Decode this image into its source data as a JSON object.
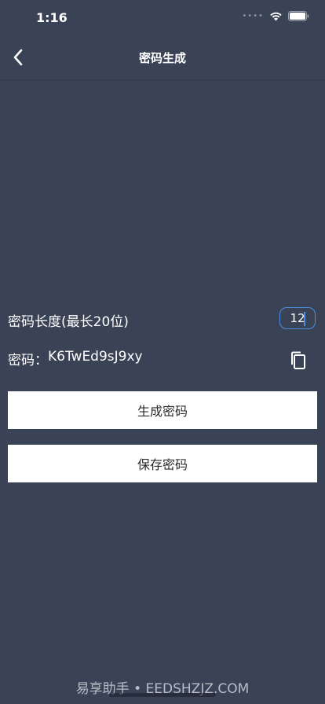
{
  "status_bar": {
    "time": "1:16",
    "icons": [
      "signal-icon",
      "wifi-icon",
      "battery-icon"
    ]
  },
  "nav": {
    "title": "密码生成",
    "back_icon": "chevron-left-icon"
  },
  "length": {
    "label": "密码长度(最长20位)",
    "value": "12"
  },
  "password": {
    "label": "密码：",
    "value": "K6TwEd9sJ9xy",
    "copy_icon": "copy-icon"
  },
  "buttons": {
    "generate": "生成密码",
    "save": "保存密码"
  },
  "watermark": "易享助手 • EEDSHZJZ.COM",
  "colors": {
    "background": "#3a4256",
    "accent": "#4a90e2",
    "button_bg": "#ffffff"
  }
}
